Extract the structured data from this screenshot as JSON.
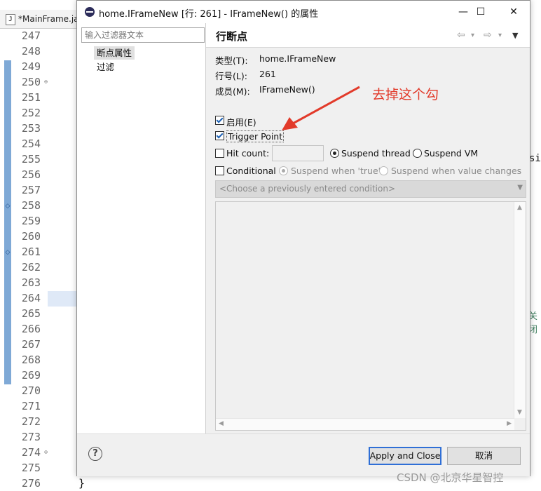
{
  "editor": {
    "tab_label": "*MainFrame.ja",
    "tab_icon": "java-file-icon",
    "line_numbers": [
      "247",
      "248",
      "249",
      "250",
      "251",
      "252",
      "253",
      "254",
      "255",
      "256",
      "257",
      "258",
      "259",
      "260",
      "261",
      "262",
      "263",
      "264",
      "265",
      "266",
      "267",
      "268",
      "269",
      "270",
      "271",
      "272",
      "273",
      "274",
      "275",
      "276"
    ],
    "closing_brace": "}",
    "right_peek_code": "si:",
    "right_peek_comment": "关闭"
  },
  "dialog": {
    "title": "home.IFrameNew [行: 261] - IFrameNew() 的属性",
    "minimize": "—",
    "maximize": "☐",
    "close": "✕",
    "filter_placeholder": "输入过滤器文本",
    "tree": [
      {
        "label": "断点属性",
        "selected": true
      },
      {
        "label": "过滤",
        "selected": false
      }
    ],
    "page_title": "行断点",
    "nav_back": "⇦",
    "nav_forward": "⇨",
    "nav_dropdown": "▾",
    "nav_menu": "▼",
    "properties": {
      "type_label": "类型(T):",
      "type_value": "home.IFrameNew",
      "line_label": "行号(L):",
      "line_value": "261",
      "member_label": "成员(M):",
      "member_value": "IFrameNew()"
    },
    "enabled_label": "启用(E)",
    "enabled_checked": true,
    "trigger_point_label": "Trigger Point",
    "trigger_point_checked": true,
    "hit_count_label": "Hit count:",
    "hit_count_checked": false,
    "hit_count_value": "",
    "suspend_thread_label": "Suspend thread",
    "suspend_vm_label": "Suspend VM",
    "suspend_mode": "thread",
    "conditional_label": "Conditional",
    "conditional_checked": false,
    "suspend_true_label": "Suspend when 'true'",
    "suspend_changes_label": "Suspend when value changes",
    "condition_combo": "<Choose a previously entered condition>",
    "help_symbol": "?",
    "apply_close_label": "Apply and Close",
    "cancel_label": "取消"
  },
  "annotation": {
    "text": "去掉这个勾",
    "color": "#e23a2a"
  },
  "watermark": "CSDN @北京华星智控"
}
